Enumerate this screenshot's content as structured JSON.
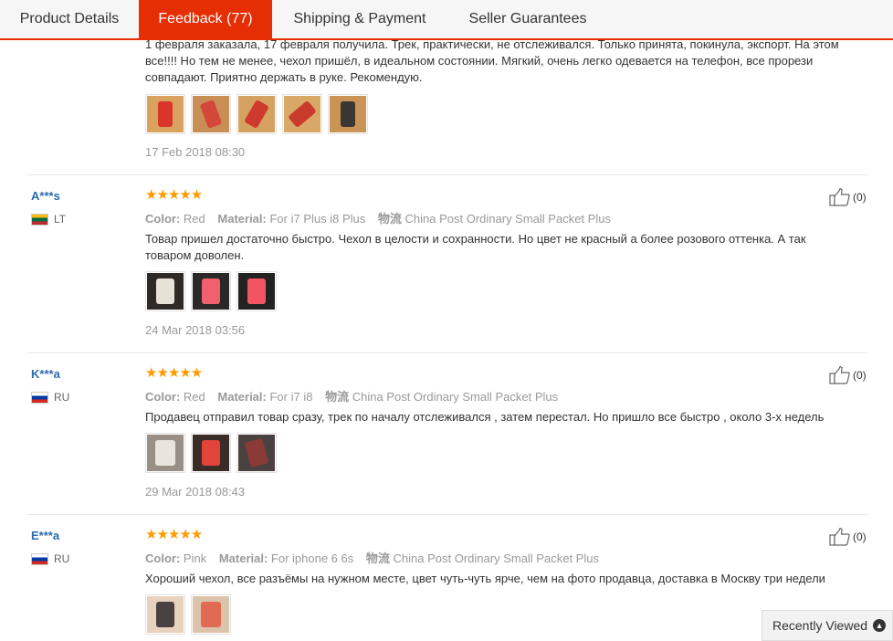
{
  "tabs": [
    {
      "label": "Product Details",
      "active": false
    },
    {
      "label": "Feedback (77)",
      "active": true
    },
    {
      "label": "Shipping & Payment",
      "active": false
    },
    {
      "label": "Seller Guarantees",
      "active": false
    }
  ],
  "accent_color": "#e62e04",
  "review0": {
    "text": [
      "1 февраля заказала, 17 февраля получила. Трек, практически, не отслеживался. Только принята, покинула, экспорт. На этом",
      "все!!!! Но тем не менее, чехол пришёл, в идеальном состоянии. Мягкий, очень легко одевается на телефон, все прорези",
      "совпадают. Приятно держать в руке. Рекомендую."
    ],
    "date": "17 Feb 2018 08:30"
  },
  "reviews": [
    {
      "user": "A***s",
      "country": "LT",
      "stars": "★★★★★",
      "color_label": "Color:",
      "color_value": "Red",
      "material_label": "Material:",
      "material_value": "For i7 Plus i8 Plus",
      "shipping_label": "物流",
      "shipping_value": "China Post Ordinary Small Packet Plus",
      "text": [
        "Товар пришел достаточно быстро. Чехол в целости и сохранности. Но цвет не красный а более розового оттенка. А так",
        "товаром доволен."
      ],
      "date": "24 Mar 2018 03:56",
      "likes": "(0)"
    },
    {
      "user": "K***a",
      "country": "RU",
      "stars": "★★★★★",
      "color_label": "Color:",
      "color_value": "Red",
      "material_label": "Material:",
      "material_value": "For i7 i8",
      "shipping_label": "物流",
      "shipping_value": "China Post Ordinary Small Packet Plus",
      "text": [
        "Продавец отправил товар сразу, трек по началу отслеживался , затем перестал. Но пришло все быстро , около 3-х недель"
      ],
      "date": "29 Mar 2018 08:43",
      "likes": "(0)"
    },
    {
      "user": "E***a",
      "country": "RU",
      "stars": "★★★★★",
      "color_label": "Color:",
      "color_value": "Pink",
      "material_label": "Material:",
      "material_value": "For iphone 6 6s",
      "shipping_label": "物流",
      "shipping_value": "China Post Ordinary Small Packet Plus",
      "text": [
        "Хороший чехол, все разъёмы на нужном месте, цвет чуть-чуть ярче, чем на фото продавца, доставка в Москву три недели"
      ],
      "likes": "(0)"
    }
  ],
  "recently_viewed": "Recently Viewed"
}
